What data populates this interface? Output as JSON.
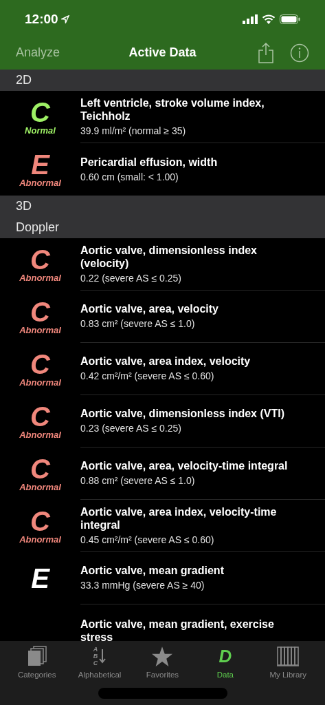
{
  "status_bar": {
    "time": "12:00"
  },
  "nav": {
    "back": "Analyze",
    "title": "Active Data"
  },
  "sections": [
    {
      "title": "2D",
      "rows": [
        {
          "grade": "C",
          "kind": "normal",
          "status": "Normal",
          "title": "Left ventricle, stroke volume index, Teichholz",
          "value": "39.9 ml/m² (normal ≥ 35)"
        },
        {
          "grade": "E",
          "kind": "abnormal",
          "status": "Abnormal",
          "title": "Pericardial effusion, width",
          "value": "0.60 cm (small: < 1.00)"
        }
      ]
    },
    {
      "title": "3D"
    },
    {
      "title": "Doppler",
      "rows": [
        {
          "grade": "C",
          "kind": "abnormal",
          "status": "Abnormal",
          "title": "Aortic valve, dimensionless index (velocity)",
          "value": "0.22 (severe AS ≤ 0.25)"
        },
        {
          "grade": "C",
          "kind": "abnormal",
          "status": "Abnormal",
          "title": "Aortic valve, area, velocity",
          "value": "0.83 cm² (severe AS ≤ 1.0)"
        },
        {
          "grade": "C",
          "kind": "abnormal",
          "status": "Abnormal",
          "title": "Aortic valve, area index, velocity",
          "value": "0.42 cm²/m² (severe AS ≤ 0.60)"
        },
        {
          "grade": "C",
          "kind": "abnormal",
          "status": "Abnormal",
          "title": "Aortic valve, dimensionless index (VTI)",
          "value": "0.23 (severe AS ≤ 0.25)"
        },
        {
          "grade": "C",
          "kind": "abnormal",
          "status": "Abnormal",
          "title": "Aortic valve, area, velocity-time integral",
          "value": "0.88 cm² (severe AS ≤ 1.0)"
        },
        {
          "grade": "C",
          "kind": "abnormal",
          "status": "Abnormal",
          "title": "Aortic valve, area index, velocity-time integral",
          "value": "0.45 cm²/m² (severe AS ≤ 0.60)"
        },
        {
          "grade": "E",
          "kind": "plain",
          "title": "Aortic valve, mean gradient",
          "value": "33.3 mmHg (severe AS ≥ 40)"
        },
        {
          "title": "Aortic valve, mean gradient, exercise stress"
        }
      ]
    }
  ],
  "tabs": [
    {
      "kind": "stack",
      "label": "Categories",
      "selected": false
    },
    {
      "kind": "abc",
      "letters": [
        "A",
        "B",
        "C"
      ],
      "label": "Alphabetical",
      "selected": false
    },
    {
      "kind": "star",
      "label": "Favorites",
      "selected": false
    },
    {
      "kind": "letter",
      "letter": "D",
      "label": "Data",
      "selected": true
    },
    {
      "kind": "library",
      "label": "My Library",
      "selected": false
    }
  ]
}
